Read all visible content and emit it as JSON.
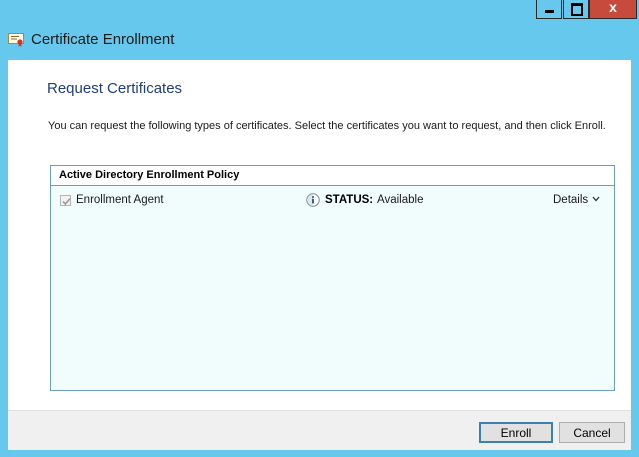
{
  "window": {
    "title": "Certificate Enrollment",
    "controls": {
      "minimize": "minimize",
      "maximize": "maximize",
      "close": "x"
    }
  },
  "page": {
    "title": "Request Certificates",
    "description": "You can request the following types of certificates. Select the certificates you want to request, and then click Enroll."
  },
  "policy": {
    "title": "Active Directory Enrollment Policy",
    "certificates": [
      {
        "name": "Enrollment Agent",
        "checked": true,
        "status_label": "STATUS:",
        "status_value": "Available",
        "details_label": "Details"
      }
    ]
  },
  "buttons": {
    "enroll": "Enroll",
    "cancel": "Cancel"
  },
  "colors": {
    "frame": "#65c8ec",
    "close": "#c74b3d",
    "title_text": "#1f3f7a",
    "policy_border": "#6a9fc5",
    "policy_bg": "#f1fcfd"
  }
}
